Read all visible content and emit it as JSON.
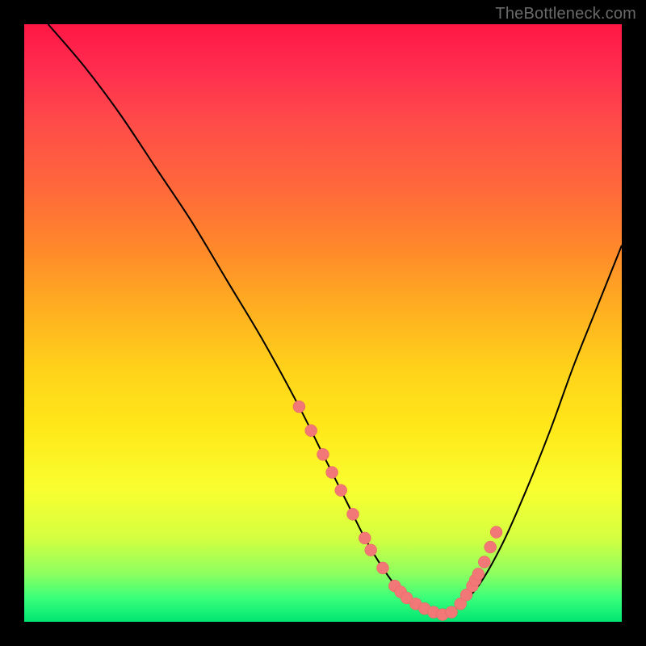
{
  "watermark": "TheBottleneck.com",
  "chart_data": {
    "type": "line",
    "title": "",
    "xlabel": "",
    "ylabel": "",
    "xlim": [
      0,
      100
    ],
    "ylim": [
      0,
      100
    ],
    "series": [
      {
        "name": "curve",
        "x": [
          4,
          10,
          16,
          22,
          28,
          34,
          40,
          46,
          50,
          54,
          57,
          60,
          63,
          66,
          68,
          70,
          72,
          76,
          80,
          84,
          88,
          92,
          96,
          100
        ],
        "y": [
          100,
          93,
          85,
          76,
          67,
          57,
          47,
          36,
          28,
          20,
          14,
          9,
          5,
          2.5,
          1.5,
          1.2,
          2,
          6,
          13,
          22,
          32,
          43,
          53,
          63
        ]
      }
    ],
    "markers": {
      "name": "dots",
      "x": [
        46,
        48,
        50,
        51.5,
        53,
        55,
        57,
        58,
        60,
        62,
        63,
        64,
        65.5,
        67,
        68.5,
        70,
        71.5,
        73,
        74,
        75,
        75.5,
        76,
        77,
        78,
        79
      ],
      "y": [
        36,
        32,
        28,
        25,
        22,
        18,
        14,
        12,
        9,
        6,
        5,
        4,
        3,
        2.2,
        1.6,
        1.2,
        1.6,
        3,
        4.5,
        6,
        7,
        8,
        10,
        12.5,
        15
      ]
    }
  }
}
